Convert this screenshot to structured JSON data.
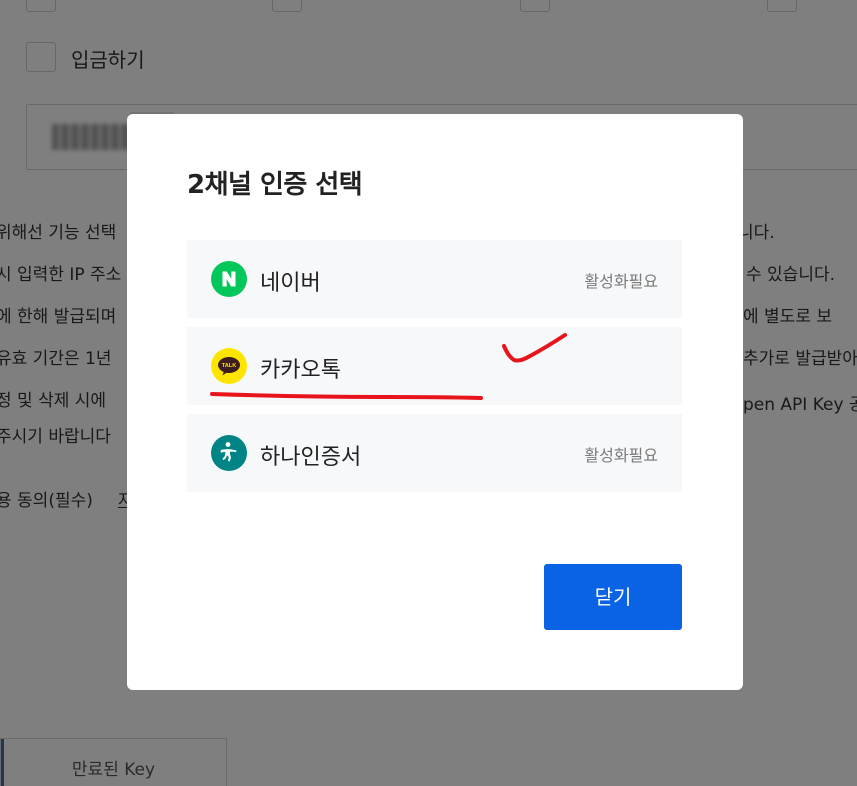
{
  "background": {
    "checkbox_deposit_label": "입금하기",
    "description_lines": [
      "위해선 기능 선택",
      "시 입력한 IP 주소",
      "에 한해 발급되며",
      "유효 기간은 1년",
      "정 및 삭제 시에",
      "주시기 바랍니다"
    ],
    "description_right_lines": [
      "니다.",
      "수 있습니다.",
      "에 별도로 보",
      "추가로 발급받아",
      "pen API Key 공"
    ],
    "consent_label": "용 동의(필수)",
    "consent_link": "자",
    "expired_key_button": "만료된 Key"
  },
  "modal": {
    "title": "2채널 인증 선택",
    "items": [
      {
        "label": "네이버",
        "status": "활성화필요",
        "icon": "naver-icon",
        "icon_color": "#03c75a"
      },
      {
        "label": "카카오톡",
        "status": "",
        "icon": "kakaotalk-icon",
        "icon_color": "#fee500"
      },
      {
        "label": "하나인증서",
        "status": "활성화필요",
        "icon": "hana-cert-icon",
        "icon_color": "#008485"
      }
    ],
    "close_button": "닫기"
  },
  "colors": {
    "primary_button": "#0a62e4",
    "annotation": "#e8141b"
  }
}
